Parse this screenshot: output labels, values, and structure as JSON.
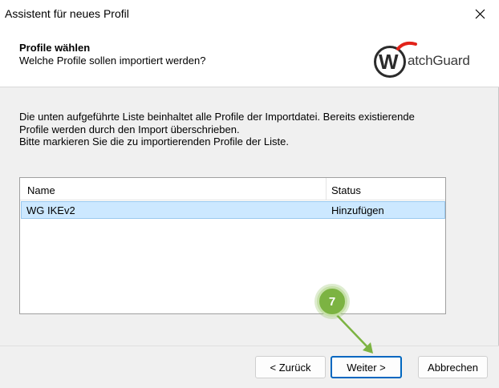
{
  "window": {
    "title": "Assistent für neues Profil",
    "close_icon": "close-icon"
  },
  "header": {
    "title": "Profile wählen",
    "subtitle": "Welche Profile sollen importiert werden?",
    "logo_text": "atchGuard",
    "logo_letter": "W"
  },
  "body": {
    "line1": "Die unten aufgeführte Liste beinhaltet alle Profile der Importdatei. Bereits existierende",
    "line2": "Profile werden durch den Import überschrieben.",
    "line3": "Bitte markieren Sie die zu importierenden Profile der Liste."
  },
  "list": {
    "columns": [
      "Name",
      "Status"
    ],
    "rows": [
      {
        "name": "WG IKEv2",
        "status": "Hinzufügen",
        "selected": true
      }
    ]
  },
  "annotation": {
    "step": "7",
    "color": "#7cb342"
  },
  "buttons": {
    "back": "< Zurück",
    "next": "Weiter >",
    "cancel": "Abbrechen"
  }
}
